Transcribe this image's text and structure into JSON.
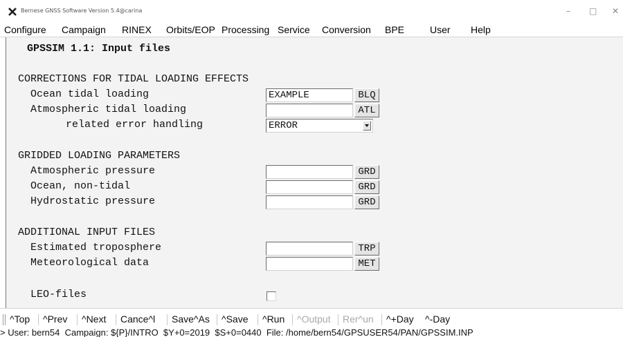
{
  "window": {
    "title": "Bernese GNSS Software Version 5.4@carina",
    "controls": {
      "minimize": "–",
      "maximize": "□",
      "close": "✕"
    },
    "icon": "x-logo-icon"
  },
  "menu": [
    "Configure",
    "Campaign",
    "RINEX",
    "Orbits/EOP",
    "Processing",
    "Service",
    "Conversion",
    "BPE",
    "User",
    "Help"
  ],
  "panel": {
    "title": "GPSSIM 1.1: Input files",
    "sections": {
      "tidal": {
        "heading": "CORRECTIONS FOR TIDAL LOADING EFFECTS",
        "ocean": {
          "label": "Ocean tidal loading",
          "value": "EXAMPLE",
          "button": "BLQ"
        },
        "atmospheric": {
          "label": "Atmospheric tidal loading",
          "value": "",
          "button": "ATL"
        },
        "error": {
          "label": "related error handling",
          "value": "ERROR"
        }
      },
      "gridded": {
        "heading": "GRIDDED LOADING PARAMETERS",
        "pressure": {
          "label": "Atmospheric pressure",
          "value": "",
          "button": "GRD"
        },
        "ocean_nontidal": {
          "label": "Ocean, non-tidal",
          "value": "",
          "button": "GRD"
        },
        "hydrostatic": {
          "label": "Hydrostatic pressure",
          "value": "",
          "button": "GRD"
        }
      },
      "additional": {
        "heading": "ADDITIONAL INPUT FILES",
        "troposphere": {
          "label": "Estimated troposphere",
          "value": "",
          "button": "TRP"
        },
        "meteo": {
          "label": "Meteorological data",
          "value": "",
          "button": "MET"
        }
      },
      "leo": {
        "label": "LEO-files",
        "checked": false
      }
    }
  },
  "commands": {
    "top": "^Top",
    "prev": "^Prev",
    "next": "^Next",
    "cancel": "Cance^l",
    "saveas": "Save^As",
    "save": "^Save",
    "run": "^Run",
    "output": "^Output",
    "rerun": "Rer^un",
    "plusday": "^+Day",
    "minusday": "^-Day"
  },
  "status": "> User: bern54  Campaign: ${P}/INTRO  $Y+0=2019  $S+0=0440  File: /home/bern54/GPSUSER54/PAN/GPSSIM.INP"
}
